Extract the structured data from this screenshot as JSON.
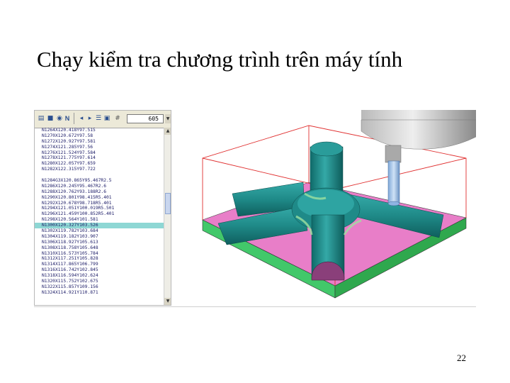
{
  "slide": {
    "title": "Chạy kiểm tra chương trình trên máy tính",
    "page_number": "22"
  },
  "editor": {
    "line_number": "605",
    "selected_index": 17,
    "lines": [
      "N1264X120.418Y97.515",
      "N1270X120.672Y97.58",
      "N1272X120.927Y97.581",
      "N1274X121.285Y97.56",
      "N1276X121.524Y97.584",
      "N1278X121.775Y97.614",
      "N1280X122.057Y97.659",
      "N1282X122.315Y97.722",
      "",
      "N1284G3X120.865Y95.467R2.5",
      "N1286X120.245Y95.467R2.6",
      "N1288X120.762Y93.188R2.6",
      "N1290X120.801Y98.415R5.401",
      "N1292X120.678Y98.718R5.401",
      "N1294X121.051Y100.019R5.501",
      "N1296X121.459Y100.852R5.401",
      "N1298X120.564Y101.581",
      "N1300X120.327Y103.526",
      "N1302X119.782Y103.684",
      "N1304X119.182Y103.907",
      "N1306X118.927Y105.613",
      "N1308X118.758Y105.648",
      "N1310X116.573Y105.784",
      "N1312X117.251Y105.828",
      "N1314X117.865Y106.799",
      "N1316X116.742Y102.845",
      "N1318X116.594Y102.624",
      "N1320X115.752Y102.675",
      "N1322X115.857Y109.156",
      "N1324X114.921Y110.871"
    ]
  },
  "colors": {
    "base_top": "#e87ec8",
    "base_side_left": "#42c86a",
    "base_side_right": "#2fa84e",
    "part": "#1f8a88",
    "bounding_box": "#e03030",
    "selection": "#8ed7d4"
  }
}
